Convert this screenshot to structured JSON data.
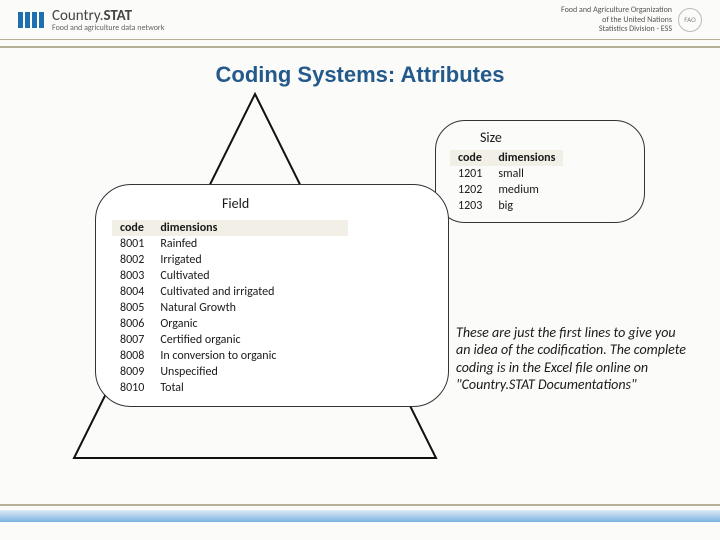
{
  "header": {
    "brand_country": "Country",
    "brand_stat": "STAT",
    "brand_sub": "Food and agriculture data network",
    "org1": "Food and Agriculture Organization",
    "org2": "of the United Nations",
    "org3": "Statistics Division - ESS",
    "fao": "FAO"
  },
  "title": "Coding Systems: Attributes",
  "size": {
    "heading": "Size",
    "head_code": "code",
    "head_dim": "dimensions",
    "rows": [
      {
        "code": "1201",
        "dim": "small"
      },
      {
        "code": "1202",
        "dim": "medium"
      },
      {
        "code": "1203",
        "dim": "big"
      }
    ]
  },
  "field": {
    "heading": "Field",
    "head_code": "code",
    "head_dim": "dimensions",
    "rows": [
      {
        "code": "8001",
        "dim": "Rainfed"
      },
      {
        "code": "8002",
        "dim": "Irrigated"
      },
      {
        "code": "8003",
        "dim": "Cultivated"
      },
      {
        "code": "8004",
        "dim": "Cultivated and irrigated"
      },
      {
        "code": "8005",
        "dim": "Natural Growth"
      },
      {
        "code": "8006",
        "dim": "Organic"
      },
      {
        "code": "8007",
        "dim": "Certified organic"
      },
      {
        "code": "8008",
        "dim": " In conversion to organic"
      },
      {
        "code": "8009",
        "dim": "Unspecified"
      },
      {
        "code": "8010",
        "dim": "Total"
      }
    ]
  },
  "note": "These are just the first lines to give you an idea of the codification. The complete coding is in the Excel file online on \"Country.STAT Documentations\""
}
